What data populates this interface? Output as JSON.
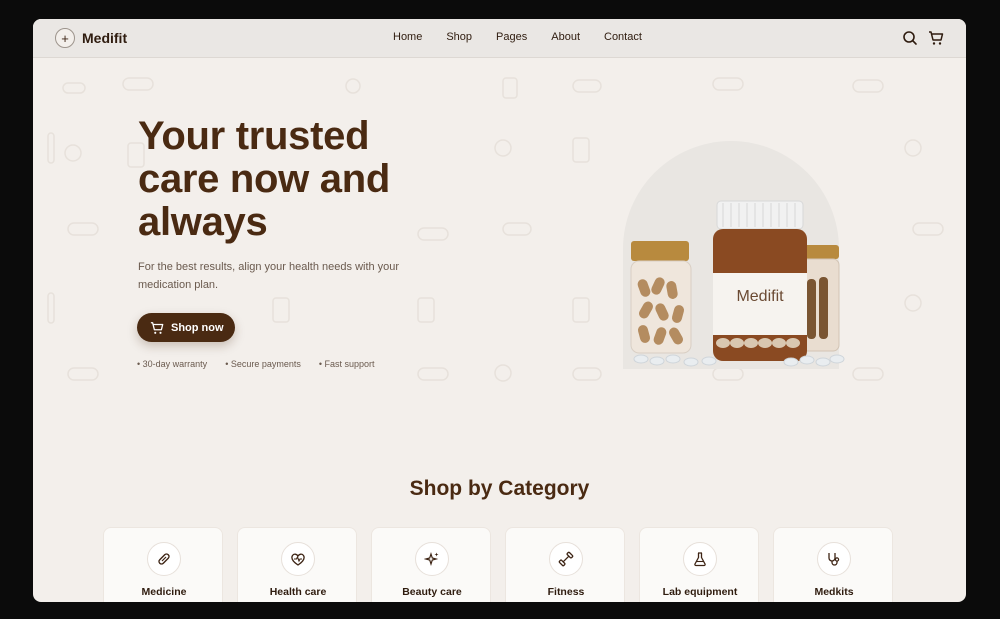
{
  "brand": {
    "name": "Medifit"
  },
  "nav": {
    "items": [
      {
        "label": "Home"
      },
      {
        "label": "Shop"
      },
      {
        "label": "Pages"
      },
      {
        "label": "About"
      },
      {
        "label": "Contact"
      }
    ]
  },
  "hero": {
    "title": "Your trusted care now and always",
    "subtitle": "For the best results, align your health needs with your medication plan.",
    "cta_label": "Shop now",
    "perks": [
      "• 30-day warranty",
      "• Secure payments",
      "• Fast support"
    ],
    "product_label": "Medifit"
  },
  "categories": {
    "title": "Shop by Category",
    "items": [
      {
        "label": "Medicine",
        "icon": "pill-icon"
      },
      {
        "label": "Health care",
        "icon": "heart-pulse-icon"
      },
      {
        "label": "Beauty care",
        "icon": "sparkle-icon"
      },
      {
        "label": "Fitness",
        "icon": "dumbbell-icon"
      },
      {
        "label": "Lab equipment",
        "icon": "flask-icon"
      },
      {
        "label": "Medkits",
        "icon": "stethoscope-icon"
      }
    ]
  },
  "colors": {
    "brand": "#4a2a12",
    "background": "#f3efeb"
  }
}
